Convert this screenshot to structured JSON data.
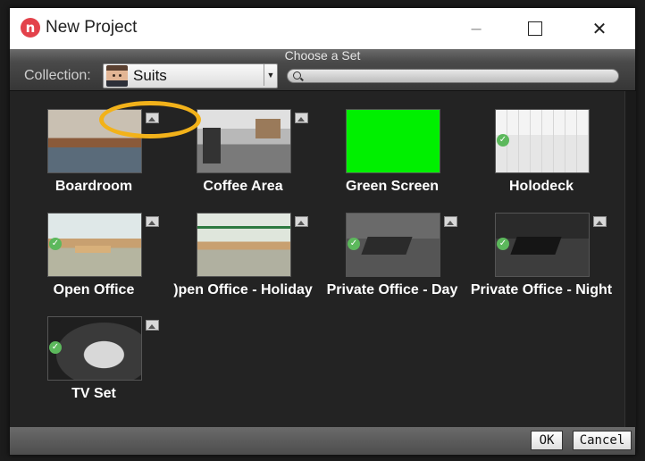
{
  "window": {
    "title": "New Project",
    "app_icon_letter": "n"
  },
  "window_controls": {
    "minimize": "–",
    "close": "✕"
  },
  "header": {
    "title": "Choose a Set"
  },
  "collection": {
    "label": "Collection:",
    "value": "Suits",
    "search_placeholder": ""
  },
  "sets": [
    {
      "label": "Boardroom",
      "scene": "boardroom",
      "image_icon": true,
      "checked": false
    },
    {
      "label": "Coffee Area",
      "scene": "coffee",
      "image_icon": true,
      "checked": false
    },
    {
      "label": "Green Screen",
      "scene": "green",
      "image_icon": false,
      "checked": false
    },
    {
      "label": "Holodeck",
      "scene": "holodeck",
      "image_icon": false,
      "checked": true
    },
    {
      "label": ")pen Office - Holiday",
      "scene": "holiday",
      "image_icon": true,
      "checked": false
    },
    {
      "label": "Open Office",
      "scene": "open",
      "image_icon": true,
      "checked": true
    },
    {
      "label": "Private Office - Day",
      "scene": "privday",
      "image_icon": true,
      "checked": true
    },
    {
      "label": "Private Office - Night",
      "scene": "privnight",
      "image_icon": true,
      "checked": true
    },
    {
      "label": "TV Set",
      "scene": "tv",
      "image_icon": true,
      "checked": true
    }
  ],
  "buttons": {
    "ok": "OK",
    "cancel": "Cancel"
  },
  "colors": {
    "highlight_ring": "#f2b21a",
    "check": "#5cb85c",
    "green_screen": "#00f000"
  }
}
